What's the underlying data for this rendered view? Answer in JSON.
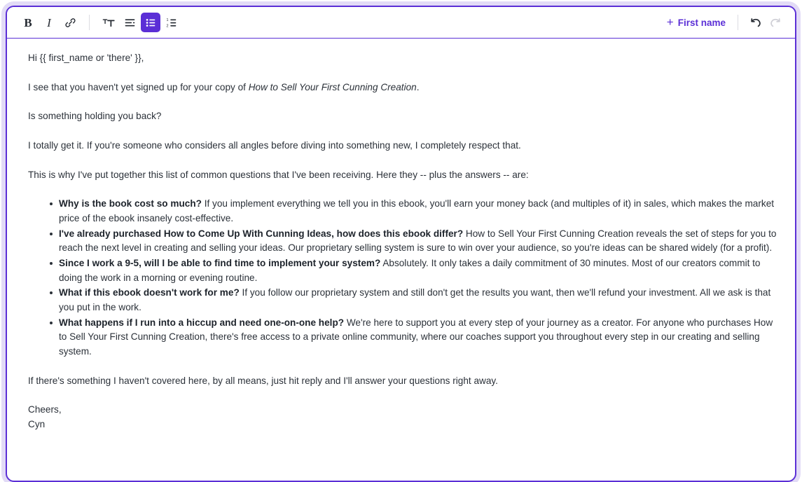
{
  "editor": {
    "accent_color": "#5b2fd6",
    "focus_ring_color": "#e2dbf6",
    "text_color": "#2b3139"
  },
  "toolbar": {
    "bold_label": "B",
    "italic_label": "I",
    "link_icon": "link-icon",
    "text_size_icon": "text-size-icon",
    "align_icon": "align-left-icon",
    "bullet_list_icon": "bulleted-list-icon",
    "numbered_list_icon": "numbered-list-icon",
    "active_button": "bulleted-list",
    "merge_tag": {
      "plus": "+",
      "label": "First name"
    },
    "undo_icon": "undo-icon",
    "redo_icon": "redo-icon",
    "undo_enabled": true,
    "redo_enabled": false
  },
  "document": {
    "greeting": "Hi {{ first_name or 'there' }},",
    "intro_prefix": "I see that you haven't yet signed up for your copy of ",
    "intro_title": "How to Sell Your First Cunning Creation",
    "intro_suffix": ".",
    "holding_back": "Is something holding you back?",
    "respect": "I totally get it. If you're someone who considers all angles before diving into something new, I completely respect that.",
    "list_lead_in": "This is why I've put together this list of common questions that I've been receiving. Here they -- plus the answers -- are:",
    "faq": [
      {
        "question": "Why is the book cost so much?",
        "answer": "If you implement everything we tell you in this ebook, you'll earn your money back (and multiples of it) in sales, which makes the market price of the ebook insanely cost-effective."
      },
      {
        "question": "I've already purchased How to Come Up With Cunning Ideas, how does this ebook differ?",
        "answer": "How to Sell Your First Cunning Creation reveals the set of steps for you to reach the next level in creating and selling your ideas. Our proprietary selling system is sure to win over your audience, so you're ideas can be shared widely (for a profit)."
      },
      {
        "question": "Since I work a 9-5, will I be able to find time to implement your system?",
        "answer": "Absolutely. It only takes a daily commitment of 30 minutes. Most of our creators commit to doing the work in a morning or evening routine."
      },
      {
        "question": "What if this ebook doesn't work for me?",
        "answer": "If you follow our proprietary system and still don't get the results you want, then we'll refund your investment. All we ask is that you put in the work."
      },
      {
        "question": "What happens if I run into a hiccup and need one-on-one help?",
        "answer": "We're here to support you at every step of your journey as a creator. For anyone who purchases How to Sell Your First Cunning Creation, there's free access to a private online community, where our coaches support you throughout every step in our creating and selling system."
      }
    ],
    "closing": "If there's something I haven't covered here, by all means, just hit reply and I'll answer your questions right away.",
    "signoff": "Cheers,",
    "signature": "Cyn"
  }
}
